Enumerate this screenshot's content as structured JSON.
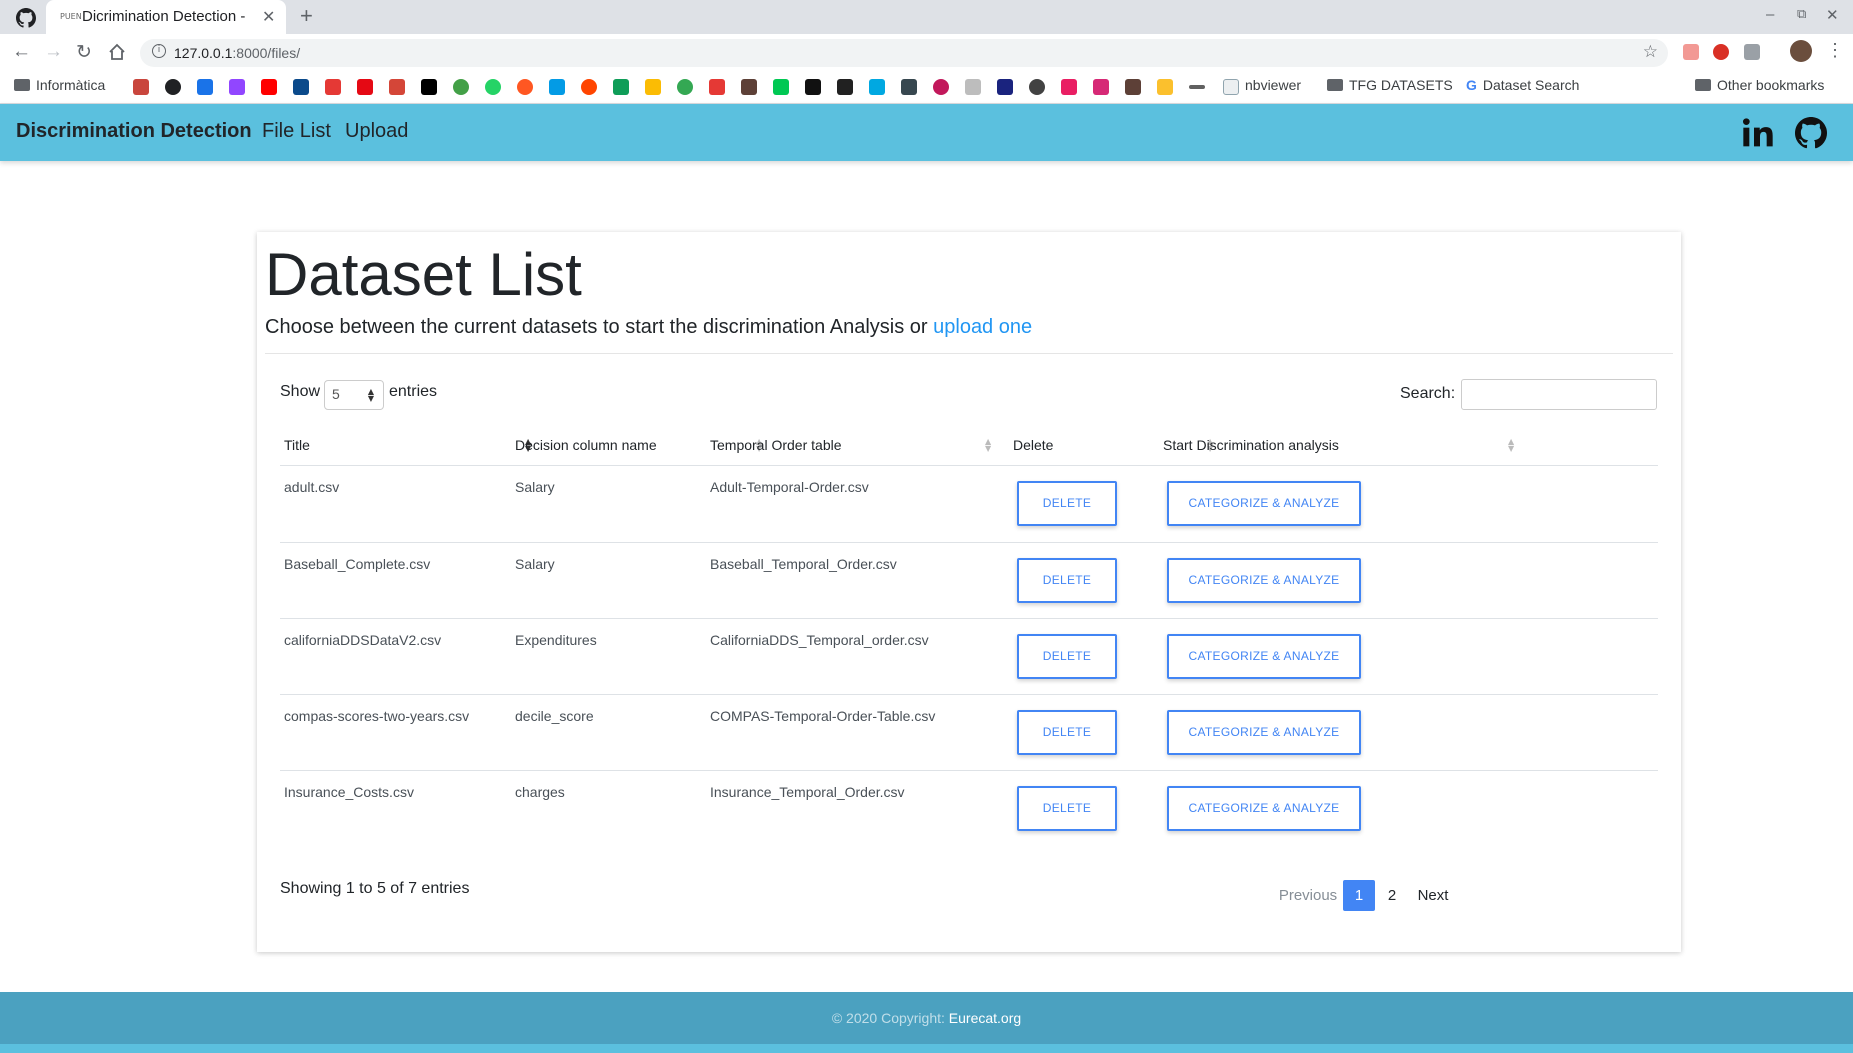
{
  "browser": {
    "tab_title": "Dicrimination Detection -",
    "tab_favicon": "PUEN",
    "url_host": "127.0.0.1",
    "url_path": ":8000/files/",
    "bookmarks": {
      "first_folder": "Informàtica",
      "nbviewer": "nbviewer",
      "tfg_folder": "TFG DATASETS",
      "dataset_search": "Dataset Search",
      "other": "Other bookmarks"
    }
  },
  "navbar": {
    "brand": "Discrimination Detection",
    "links": [
      "File List",
      "Upload"
    ],
    "bg_color": "#5bc0de"
  },
  "header": {
    "title": "Dataset List",
    "lead_text": "Choose between the current datasets to start the discrimination Analysis or ",
    "lead_link": "upload one"
  },
  "controls": {
    "show_label": "Show",
    "page_size": "5",
    "entries_label": "entries",
    "search_label": "Search:",
    "search_value": ""
  },
  "table": {
    "columns": [
      "Title",
      "Decision column name",
      "Temporal Order table",
      "Delete",
      "Start Discrimination analysis"
    ],
    "rows": [
      {
        "title": "adult.csv",
        "decision": "Salary",
        "temporal": "Adult-Temporal-Order.csv"
      },
      {
        "title": "Baseball_Complete.csv",
        "decision": "Salary",
        "temporal": "Baseball_Temporal_Order.csv"
      },
      {
        "title": "californiaDDSDataV2.csv",
        "decision": "Expenditures",
        "temporal": "CaliforniaDDS_Temporal_order.csv"
      },
      {
        "title": "compas-scores-two-years.csv",
        "decision": "decile_score",
        "temporal": "COMPAS-Temporal-Order-Table.csv"
      },
      {
        "title": "Insurance_Costs.csv",
        "decision": "charges",
        "temporal": "Insurance_Temporal_Order.csv"
      }
    ],
    "delete_label": "DELETE",
    "analyze_label": "CATEGORIZE & ANALYZE",
    "button_color": "#4285f4"
  },
  "pagination": {
    "info": "Showing 1 to 5 of 7 entries",
    "previous": "Previous",
    "current": "1",
    "page2": "2",
    "next": "Next"
  },
  "footer": {
    "copyright": "© 2020 Copyright: ",
    "link": "Eurecat.org"
  }
}
